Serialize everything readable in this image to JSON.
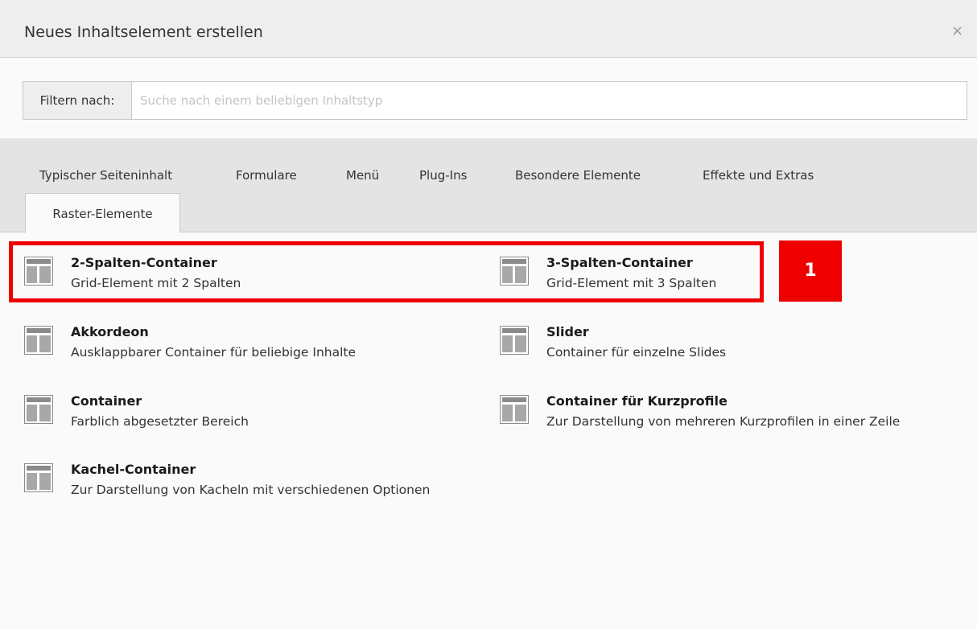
{
  "dialog": {
    "title": "Neues Inhaltselement erstellen",
    "close_label": "×"
  },
  "filter": {
    "label": "Filtern nach:",
    "value": "",
    "placeholder": "Suche nach einem beliebigen Inhaltstyp"
  },
  "tabs": [
    {
      "label": "Typischer Seiteninhalt",
      "active": false
    },
    {
      "label": "Formulare",
      "active": false
    },
    {
      "label": "Menü",
      "active": false
    },
    {
      "label": "Plug-Ins",
      "active": false
    },
    {
      "label": "Besondere Elemente",
      "active": false
    },
    {
      "label": "Effekte und Extras",
      "active": false
    },
    {
      "label": "Raster-Elemente",
      "active": true
    }
  ],
  "elements": [
    {
      "title": "2-Spalten-Container",
      "description": "Grid-Element mit 2 Spalten",
      "icon": "grid-layout-icon"
    },
    {
      "title": "3-Spalten-Container",
      "description": "Grid-Element mit 3 Spalten",
      "icon": "grid-layout-icon"
    },
    {
      "title": "Akkordeon",
      "description": "Ausklappbarer Container für beliebige Inhalte",
      "icon": "grid-layout-icon"
    },
    {
      "title": "Slider",
      "description": "Container für einzelne Slides",
      "icon": "grid-layout-icon"
    },
    {
      "title": "Container",
      "description": "Farblich abgesetzter Bereich",
      "icon": "grid-layout-icon"
    },
    {
      "title": "Container für Kurzprofile",
      "description": "Zur Darstellung von mehreren Kurzprofilen in einer Zeile",
      "icon": "grid-layout-icon"
    },
    {
      "title": "Kachel-Container",
      "description": "Zur Darstellung von Kacheln mit verschiedenen Optionen",
      "icon": "grid-layout-icon"
    }
  ],
  "annotation": {
    "badge": "1",
    "color": "#ee0000"
  }
}
